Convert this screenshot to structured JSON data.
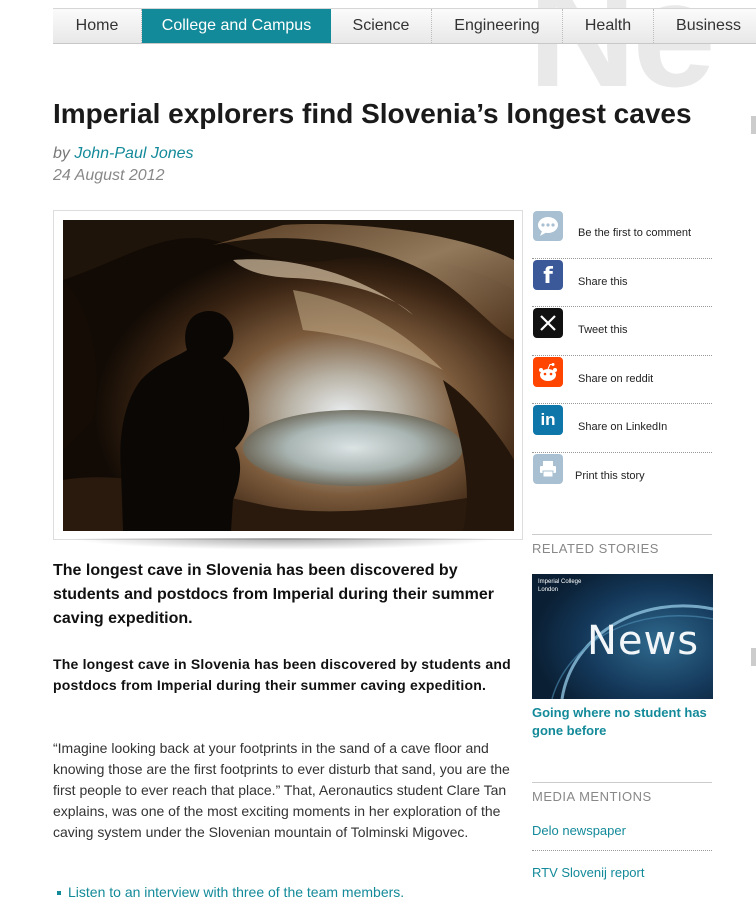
{
  "nav": {
    "items": [
      {
        "label": "Home",
        "active": false
      },
      {
        "label": "College and Campus",
        "active": true
      },
      {
        "label": "Science",
        "active": false
      },
      {
        "label": "Engineering",
        "active": false
      },
      {
        "label": "Health",
        "active": false
      },
      {
        "label": "Business",
        "active": false
      }
    ]
  },
  "watermark": "Ne",
  "article": {
    "title": "Imperial explorers find Slovenia’s longest caves",
    "byline_prefix": "by ",
    "author": "John-Paul Jones",
    "date": "24 August 2012",
    "lead": "The longest cave in Slovenia has been discovered by students and postdocs from Imperial during their summer caving expedition.",
    "lead2": "The longest cave in Slovenia has been discovered by students and postdocs from Imperial during their summer caving expedition.",
    "paragraph": "“Imagine looking back at your footprints in the sand of a cave floor and knowing those are the first footprints to ever disturb that sand, you are the first people to ever reach that place.” That, Aeronautics student Clare Tan explains, was one of the most exciting moments in her exploration of the caving system under the Slovenian mountain of Tolminski Migovec.",
    "bullet_link": "Listen to an interview with three of the team members."
  },
  "share": {
    "items": [
      {
        "label": "Be the first to comment",
        "icon": "comment-icon",
        "color": "#9fb9cc"
      },
      {
        "label": "Share this",
        "icon": "facebook-icon",
        "color": "#3b5998"
      },
      {
        "label": "Tweet this",
        "icon": "x-icon",
        "color": "#111111"
      },
      {
        "label": "Share on reddit",
        "icon": "reddit-icon",
        "color": "#ff4500"
      },
      {
        "label": "Share on LinkedIn",
        "icon": "linkedin-icon",
        "color": "#0e76a8"
      },
      {
        "label": "Print this story",
        "icon": "print-icon",
        "color": "#9fb9cc"
      }
    ]
  },
  "related": {
    "heading": "RELATED STORIES",
    "card_brand_line1": "Imperial College",
    "card_brand_line2": "London",
    "card_word": "News",
    "link": "Going where no student has gone before"
  },
  "mentions": {
    "heading": "MEDIA MENTIONS",
    "items": [
      "Delo newspaper",
      "RTV Slovenij report"
    ]
  },
  "colors": {
    "accent": "#138a99"
  }
}
